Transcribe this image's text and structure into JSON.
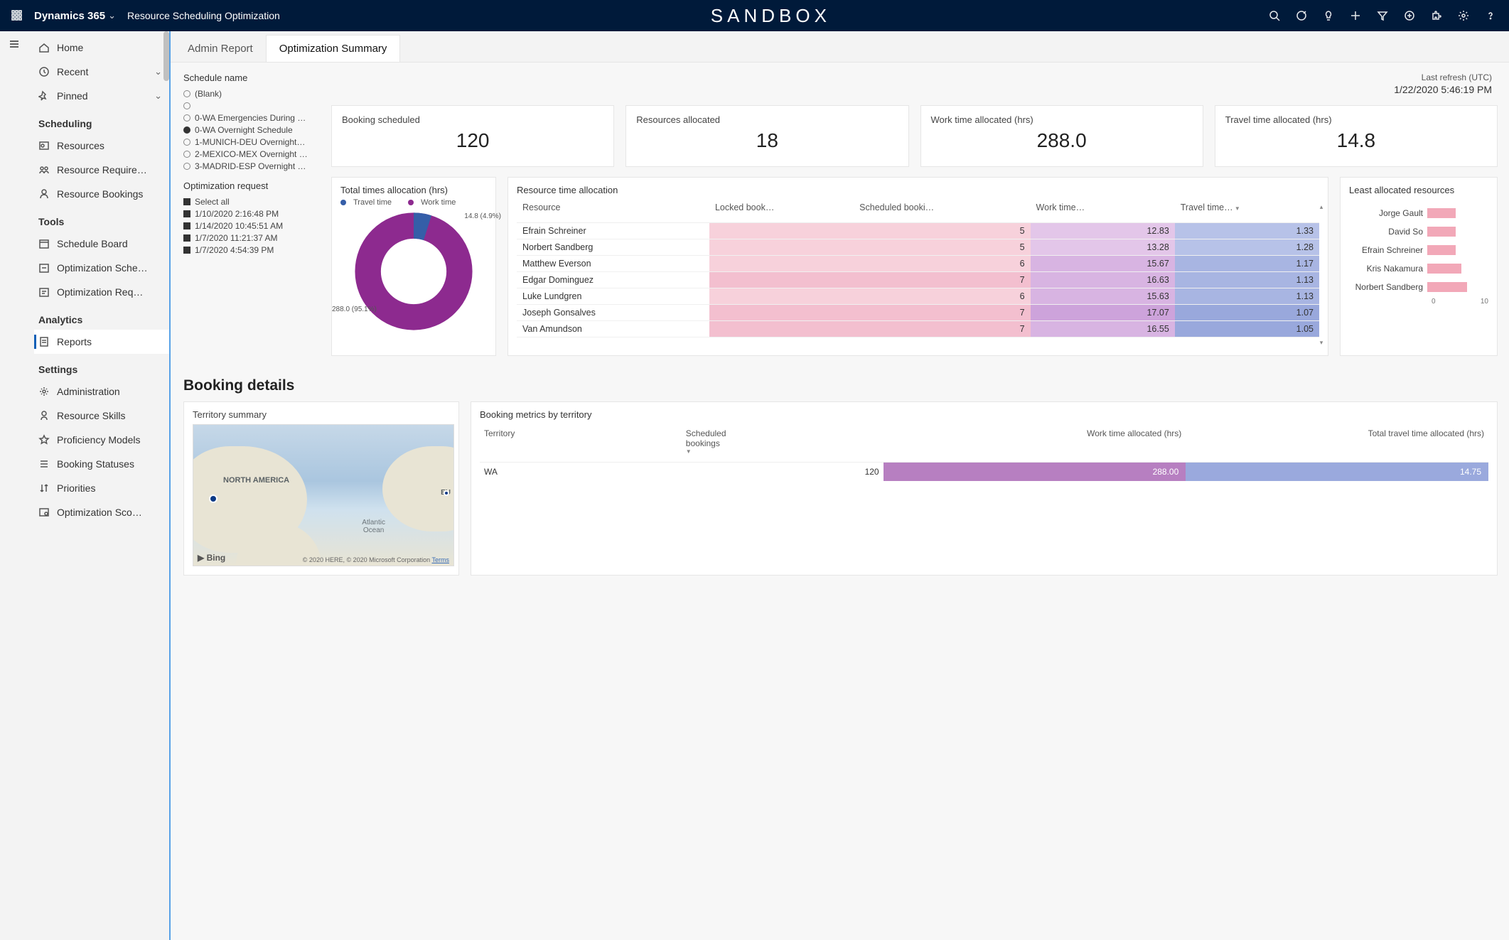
{
  "topbar": {
    "brand": "Dynamics 365",
    "app_title": "Resource Scheduling Optimization",
    "sandbox": "SANDBOX"
  },
  "sidebar": {
    "home": "Home",
    "recent": "Recent",
    "pinned": "Pinned",
    "groups": {
      "scheduling": "Scheduling",
      "tools": "Tools",
      "analytics": "Analytics",
      "settings": "Settings"
    },
    "items": {
      "resources": "Resources",
      "resource_require": "Resource Require…",
      "resource_bookings": "Resource Bookings",
      "schedule_board": "Schedule Board",
      "optimization_sche": "Optimization Sche…",
      "optimization_req": "Optimization Req…",
      "reports": "Reports",
      "administration": "Administration",
      "resource_skills": "Resource Skills",
      "proficiency_models": "Proficiency Models",
      "booking_statuses": "Booking Statuses",
      "priorities": "Priorities",
      "optimization_sco": "Optimization Sco…"
    }
  },
  "tabs": {
    "admin": "Admin Report",
    "summary": "Optimization Summary"
  },
  "refresh": {
    "label": "Last refresh (UTC)",
    "ts": "1/22/2020 5:46:19 PM"
  },
  "filters": {
    "schedule_name_label": "Schedule name",
    "schedule_names": [
      {
        "label": "(Blank)",
        "selected": false
      },
      {
        "label": "",
        "selected": false
      },
      {
        "label": "0-WA Emergencies During …",
        "selected": false
      },
      {
        "label": "0-WA Overnight Schedule",
        "selected": true
      },
      {
        "label": "1-MUNICH-DEU Overnight…",
        "selected": false
      },
      {
        "label": "2-MEXICO-MEX Overnight …",
        "selected": false
      },
      {
        "label": "3-MADRID-ESP Overnight …",
        "selected": false
      }
    ],
    "opt_request_label": "Optimization request",
    "opt_requests": [
      "Select all",
      "1/10/2020 2:16:48 PM",
      "1/14/2020 10:45:51 AM",
      "1/7/2020 11:21:37 AM",
      "1/7/2020 4:54:39 PM"
    ]
  },
  "kpis": {
    "booking_scheduled": {
      "label": "Booking scheduled",
      "value": "120"
    },
    "resources_allocated": {
      "label": "Resources allocated",
      "value": "18"
    },
    "work_time": {
      "label": "Work time allocated (hrs)",
      "value": "288.0"
    },
    "travel_time": {
      "label": "Travel time allocated (hrs)",
      "value": "14.8"
    }
  },
  "donut": {
    "title": "Total times allocation (hrs)",
    "legend_travel": "Travel time",
    "legend_work": "Work time",
    "lbl_travel": "14.8 (4.9%)",
    "lbl_work": "288.0 (95.1%)"
  },
  "rtable": {
    "title": "Resource time allocation",
    "cols": {
      "resource": "Resource",
      "locked": "Locked book…",
      "scheduled": "Scheduled booki…",
      "work": "Work time…",
      "travel": "Travel time…"
    },
    "rows": [
      {
        "r": "Efrain Schreiner",
        "s": "5",
        "w": "12.83",
        "t": "1.33"
      },
      {
        "r": "Norbert Sandberg",
        "s": "5",
        "w": "13.28",
        "t": "1.28"
      },
      {
        "r": "Matthew Everson",
        "s": "6",
        "w": "15.67",
        "t": "1.17"
      },
      {
        "r": "Edgar Dominguez",
        "s": "7",
        "w": "16.63",
        "t": "1.13"
      },
      {
        "r": "Luke Lundgren",
        "s": "6",
        "w": "15.63",
        "t": "1.13"
      },
      {
        "r": "Joseph Gonsalves",
        "s": "7",
        "w": "17.07",
        "t": "1.07"
      },
      {
        "r": "Van Amundson",
        "s": "7",
        "w": "16.55",
        "t": "1.05"
      }
    ]
  },
  "least": {
    "title": "Least allocated resources",
    "rows": [
      {
        "name": "Jorge Gault",
        "v": 5
      },
      {
        "name": "David So",
        "v": 5
      },
      {
        "name": "Efrain Schreiner",
        "v": 5
      },
      {
        "name": "Kris Nakamura",
        "v": 6
      },
      {
        "name": "Norbert Sandberg",
        "v": 7
      }
    ],
    "axis0": "0",
    "axis1": "10"
  },
  "booking": {
    "header": "Booking details",
    "territory_summary": "Territory summary",
    "metrics_title": "Booking metrics by territory",
    "cols": {
      "territory": "Territory",
      "scheduled": "Scheduled bookings",
      "work": "Work time allocated (hrs)",
      "travel": "Total travel time allocated (hrs)"
    },
    "row": {
      "territory": "WA",
      "scheduled": "120",
      "work": "288.00",
      "travel": "14.75"
    },
    "map": {
      "na": "NORTH AMERICA",
      "ao": "Atlantic\nOcean",
      "eu": "EU",
      "bing": "▶ Bing",
      "credits": "© 2020 HERE, © 2020 Microsoft Corporation",
      "terms": "Terms"
    }
  },
  "chart_data": [
    {
      "type": "pie",
      "title": "Total times allocation (hrs)",
      "series": [
        {
          "name": "Travel time",
          "value": 14.8,
          "pct": 4.9,
          "color": "#355ea8"
        },
        {
          "name": "Work time",
          "value": 288.0,
          "pct": 95.1,
          "color": "#8d2a8f"
        }
      ]
    },
    {
      "type": "table",
      "title": "Resource time allocation",
      "columns": [
        "Resource",
        "Locked bookings",
        "Scheduled bookings",
        "Work time (hrs)",
        "Travel time (hrs)"
      ],
      "rows": [
        [
          "Efrain Schreiner",
          null,
          5,
          12.83,
          1.33
        ],
        [
          "Norbert Sandberg",
          null,
          5,
          13.28,
          1.28
        ],
        [
          "Matthew Everson",
          null,
          6,
          15.67,
          1.17
        ],
        [
          "Edgar Dominguez",
          null,
          7,
          16.63,
          1.13
        ],
        [
          "Luke Lundgren",
          null,
          6,
          15.63,
          1.13
        ],
        [
          "Joseph Gonsalves",
          null,
          7,
          17.07,
          1.07
        ],
        [
          "Van Amundson",
          null,
          7,
          16.55,
          1.05
        ]
      ]
    },
    {
      "type": "bar",
      "title": "Least allocated resources",
      "orientation": "horizontal",
      "categories": [
        "Jorge Gault",
        "David So",
        "Efrain Schreiner",
        "Kris Nakamura",
        "Norbert Sandberg"
      ],
      "values": [
        5,
        5,
        5,
        6,
        7
      ],
      "xlim": [
        0,
        10
      ]
    },
    {
      "type": "table",
      "title": "Booking metrics by territory",
      "columns": [
        "Territory",
        "Scheduled bookings",
        "Work time allocated (hrs)",
        "Total travel time allocated (hrs)"
      ],
      "rows": [
        [
          "WA",
          120,
          288.0,
          14.75
        ]
      ]
    }
  ]
}
